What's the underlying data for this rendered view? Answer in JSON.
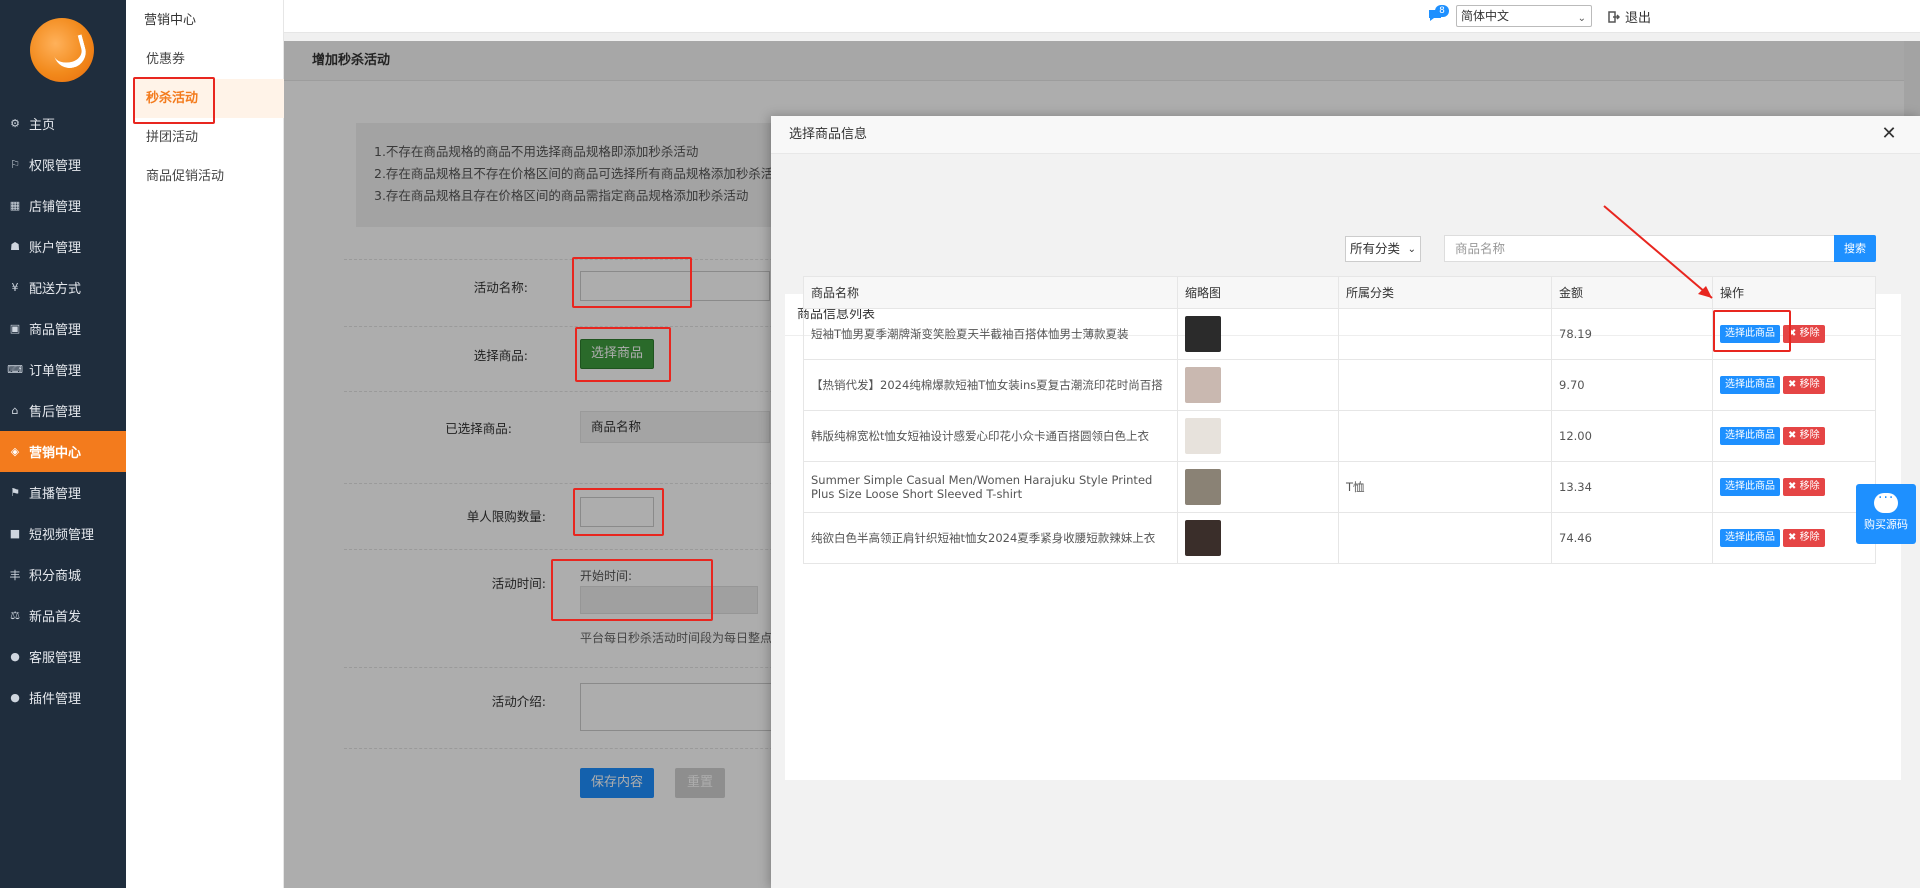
{
  "sidebar": {
    "items": [
      {
        "label": "主页",
        "icon": "gear-icon",
        "glyph": "⚙"
      },
      {
        "label": "权限管理",
        "icon": "sitemap-icon",
        "glyph": "⚐"
      },
      {
        "label": "店铺管理",
        "icon": "map-icon",
        "glyph": "▦"
      },
      {
        "label": "账户管理",
        "icon": "users-icon",
        "glyph": "☗"
      },
      {
        "label": "配送方式",
        "icon": "yen-icon",
        "glyph": "¥"
      },
      {
        "label": "商品管理",
        "icon": "image-icon",
        "glyph": "▣"
      },
      {
        "label": "订单管理",
        "icon": "keyboard-icon",
        "glyph": "⌨"
      },
      {
        "label": "售后管理",
        "icon": "bank-icon",
        "glyph": "⌂"
      },
      {
        "label": "营销中心",
        "icon": "tag-icon",
        "glyph": "◈",
        "active": true
      },
      {
        "label": "直播管理",
        "icon": "flag-icon",
        "glyph": "⚑"
      },
      {
        "label": "短视频管理",
        "icon": "video-icon",
        "glyph": "■"
      },
      {
        "label": "积分商城",
        "icon": "points-icon",
        "glyph": "丰"
      },
      {
        "label": "新品首发",
        "icon": "scale-icon",
        "glyph": "⚖"
      },
      {
        "label": "客服管理",
        "icon": "chat-icon",
        "glyph": "●"
      },
      {
        "label": "插件管理",
        "icon": "plugin-icon",
        "glyph": "●"
      }
    ]
  },
  "subsidebar": {
    "title": "营销中心",
    "items": [
      {
        "label": "优惠券"
      },
      {
        "label": "秒杀活动",
        "active": true
      },
      {
        "label": "拼团活动"
      },
      {
        "label": "商品促销活动"
      }
    ]
  },
  "topbar": {
    "badge": "8",
    "language": "简体中文",
    "logout": "退出"
  },
  "page": {
    "title": "增加秒杀活动",
    "tips": [
      "1.不存在商品规格的商品不用选择商品规格即添加秒杀活动",
      "2.存在商品规格且不存在价格区间的商品可选择所有商品规格添加秒杀活",
      "3.存在商品规格且存在价格区间的商品需指定商品规格添加秒杀活动"
    ],
    "form": {
      "name_label": "活动名称:",
      "goods_label": "选择商品:",
      "goods_button": "选择商品",
      "selected_label": "已选择商品:",
      "selected_header": "商品名称",
      "limit_label": "单人限购数量:",
      "time_label": "活动时间:",
      "start_label": "开始时间:",
      "time_hint": "平台每日秒杀活动时间段为每日整点,",
      "intro_label": "活动介绍:",
      "save": "保存内容",
      "reset": "重置"
    }
  },
  "modal": {
    "title": "选择商品信息",
    "card_title": "商品信息列表",
    "category_select": "所有分类",
    "search_placeholder": "商品名称",
    "search_button": "搜索",
    "columns": [
      "商品名称",
      "缩略图",
      "所属分类",
      "金额",
      "操作"
    ],
    "rows": [
      {
        "name": "短袖T恤男夏季潮牌渐变笑脸夏天半截袖百搭体恤男士薄款夏装",
        "category": "",
        "price": "78.19",
        "thumb": "#2b2b2b"
      },
      {
        "name": "【热销代发】2024纯棉爆款短袖T恤女装ins夏复古潮流印花时尚百搭",
        "category": "",
        "price": "9.70",
        "thumb": "#c9b8b0"
      },
      {
        "name": "韩版纯棉宽松t恤女短袖设计感爱心印花小众卡通百搭圆领白色上衣",
        "category": "",
        "price": "12.00",
        "thumb": "#e7e2dc"
      },
      {
        "name": "Summer Simple Casual Men/Women Harajuku Style Printed Plus Size Loose Short Sleeved T-shirt",
        "category": "T恤",
        "price": "13.34",
        "thumb": "#8a8275"
      },
      {
        "name": "纯欲白色半高领正肩针织短袖t恤女2024夏季紧身收腰短款辣妹上衣",
        "category": "",
        "price": "74.46",
        "thumb": "#3a2e2a"
      }
    ],
    "select_button": "选择此商品",
    "remove_button": "移除",
    "remove_glyph": "✖"
  },
  "chat": {
    "label": "购买源码"
  },
  "colors": {
    "sidebar_bg": "#1f2d3d",
    "accent": "#f37b1d",
    "primary": "#1e90ff",
    "danger": "#e54545",
    "annotation": "#e8261f"
  }
}
